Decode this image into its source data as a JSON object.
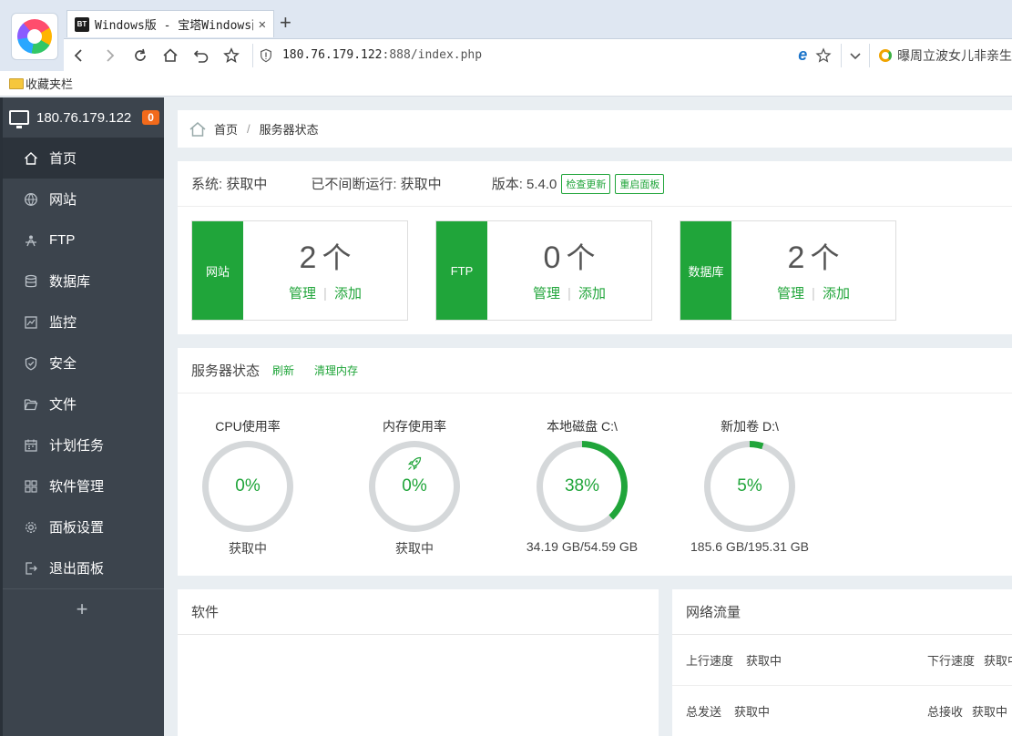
{
  "browser": {
    "tab_title": "Windows版 - 宝塔Windows面板",
    "tab_favicon_text": "BT",
    "url_host": "180.76.179.122",
    "url_path": ":888/index.php",
    "search_text": "曝周立波女儿非亲生",
    "bookmarks_label": "收藏夹栏"
  },
  "sidebar": {
    "server_ip": "180.76.179.122",
    "badge": "0",
    "items": [
      {
        "label": "首页",
        "icon": "home-icon"
      },
      {
        "label": "网站",
        "icon": "globe-icon"
      },
      {
        "label": "FTP",
        "icon": "ftp-icon"
      },
      {
        "label": "数据库",
        "icon": "database-icon"
      },
      {
        "label": "监控",
        "icon": "monitor-chart-icon"
      },
      {
        "label": "安全",
        "icon": "shield-icon"
      },
      {
        "label": "文件",
        "icon": "folder-icon"
      },
      {
        "label": "计划任务",
        "icon": "calendar-icon"
      },
      {
        "label": "软件管理",
        "icon": "grid-icon"
      },
      {
        "label": "面板设置",
        "icon": "gear-icon"
      },
      {
        "label": "退出面板",
        "icon": "logout-icon"
      }
    ],
    "add_label": "+"
  },
  "breadcrumb": {
    "home": "首页",
    "separator": "/",
    "current": "服务器状态"
  },
  "system": {
    "os_label": "系统: 获取中",
    "uptime_label": "已不间断运行: 获取中",
    "version_label": "版本: 5.4.0",
    "check_update": "检查更新",
    "restart_panel": "重启面板"
  },
  "cards": [
    {
      "side": "网站",
      "count": "2",
      "unit": "个",
      "manage": "管理",
      "add": "添加"
    },
    {
      "side": "FTP",
      "count": "0",
      "unit": "个",
      "manage": "管理",
      "add": "添加"
    },
    {
      "side": "数据库",
      "count": "2",
      "unit": "个",
      "manage": "管理",
      "add": "添加"
    }
  ],
  "server_status": {
    "title": "服务器状态",
    "refresh": "刷新",
    "clear_memory": "清理内存",
    "gauges": [
      {
        "title": "CPU使用率",
        "value": "0%",
        "percent": 0,
        "footer": "获取中"
      },
      {
        "title": "内存使用率",
        "value": "0%",
        "percent": 0,
        "footer": "获取中",
        "icon": "rocket-icon"
      },
      {
        "title": "本地磁盘 C:\\",
        "value": "38%",
        "percent": 38,
        "footer": "34.19 GB/54.59 GB"
      },
      {
        "title": "新加卷 D:\\",
        "value": "5%",
        "percent": 5,
        "footer": "185.6 GB/195.31 GB"
      }
    ]
  },
  "software": {
    "title": "软件"
  },
  "network": {
    "title": "网络流量",
    "up_speed_label": "上行速度",
    "up_speed_value": "获取中",
    "down_speed_label": "下行速度",
    "down_speed_value": "获取中",
    "total_sent_label": "总发送",
    "total_sent_value": "获取中",
    "total_recv_label": "总接收",
    "total_recv_value": "获取中"
  },
  "colors": {
    "accent": "#20a53a",
    "sidebar_bg": "#3c444d",
    "badge": "#f26a1b",
    "gauge_track": "#d5d8da"
  }
}
